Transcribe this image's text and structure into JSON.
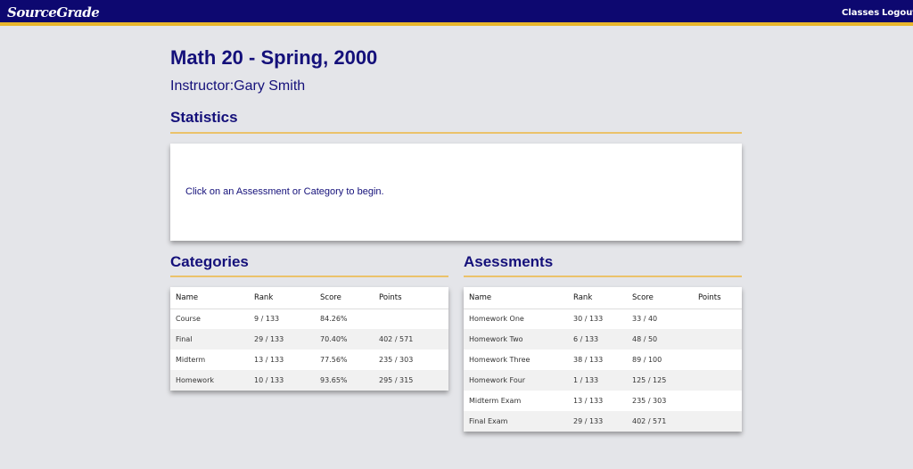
{
  "app": {
    "brand": "SourceGrade"
  },
  "nav": {
    "classes": "Classes",
    "logout": "Logout"
  },
  "course": {
    "title": "Math 20 - Spring, 2000",
    "instructor_label": "Instructor:",
    "instructor_name": "Gary Smith"
  },
  "statistics": {
    "heading": "Statistics",
    "message": "Click on an Assessment or Category to begin."
  },
  "categories": {
    "heading": "Categories",
    "columns": [
      "Name",
      "Rank",
      "Score",
      "Points"
    ],
    "rows": [
      [
        "Course",
        "9 / 133",
        "84.26%",
        ""
      ],
      [
        "Final",
        "29 / 133",
        "70.40%",
        "402 / 571"
      ],
      [
        "Midterm",
        "13 / 133",
        "77.56%",
        "235 / 303"
      ],
      [
        "Homework",
        "10 / 133",
        "93.65%",
        "295 / 315"
      ]
    ]
  },
  "assessments": {
    "heading": "Asessments",
    "columns": [
      "Name",
      "Rank",
      "Score",
      "Points"
    ],
    "rows": [
      [
        "Homework One",
        "30 / 133",
        "33 / 40",
        ""
      ],
      [
        "Homework Two",
        "6 / 133",
        "48 / 50",
        ""
      ],
      [
        "Homework Three",
        "38 / 133",
        "89 / 100",
        ""
      ],
      [
        "Homework Four",
        "1 / 133",
        "125 / 125",
        ""
      ],
      [
        "Midterm Exam",
        "13 / 133",
        "235 / 303",
        ""
      ],
      [
        "Final Exam",
        "29 / 133",
        "402 / 571",
        ""
      ]
    ]
  },
  "colors": {
    "navbar": "#0d0870",
    "accent": "#e8b62c",
    "heading_text": "#14107a",
    "background": "#e4e5e9"
  }
}
